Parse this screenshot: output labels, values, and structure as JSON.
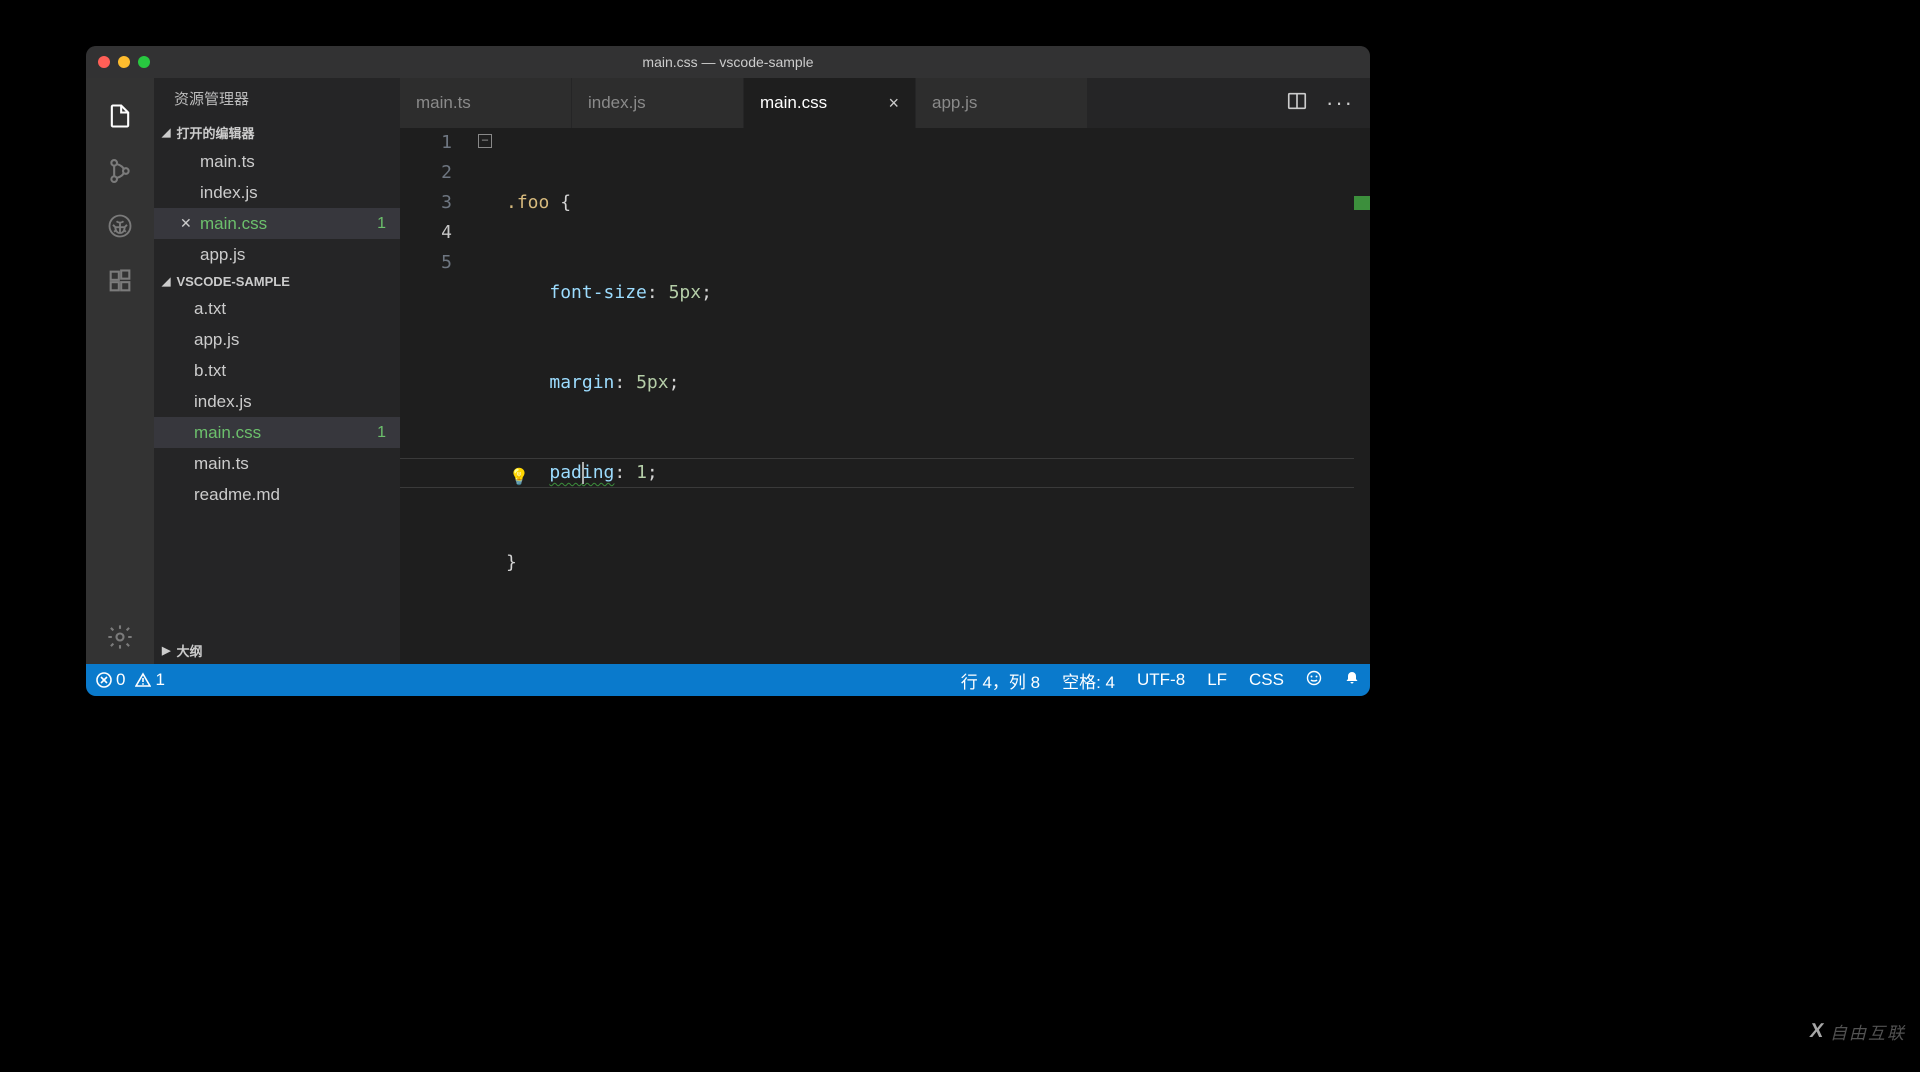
{
  "titlebar": {
    "title": "main.css — vscode-sample"
  },
  "sidebar": {
    "title": "资源管理器",
    "open_editors_label": "打开的编辑器",
    "workspace_label": "VSCODE-SAMPLE",
    "outline_label": "大纲",
    "open_editors": [
      {
        "name": "main.ts"
      },
      {
        "name": "index.js"
      },
      {
        "name": "main.css",
        "active": true,
        "badge": "1"
      },
      {
        "name": "app.js"
      }
    ],
    "files": [
      {
        "name": "a.txt"
      },
      {
        "name": "app.js"
      },
      {
        "name": "b.txt"
      },
      {
        "name": "index.js"
      },
      {
        "name": "main.css",
        "active": true,
        "badge": "1"
      },
      {
        "name": "main.ts"
      },
      {
        "name": "readme.md"
      }
    ]
  },
  "tabs": [
    {
      "label": "main.ts"
    },
    {
      "label": "index.js"
    },
    {
      "label": "main.css",
      "active": true
    },
    {
      "label": "app.js"
    }
  ],
  "code": {
    "l1_sel": ".foo",
    "l1_rest": " {",
    "l2_prop": "font-size",
    "l2_val": "5px",
    "l3_prop": "margin",
    "l3_val": "5px",
    "l4_prop_a": "pad",
    "l4_prop_b": "ing",
    "l4_val": "1",
    "l5": "}"
  },
  "status": {
    "errors": "0",
    "warnings": "1",
    "cursor": "行 4，列 8",
    "spaces": "空格: 4",
    "encoding": "UTF-8",
    "eol": "LF",
    "lang": "CSS"
  },
  "watermark": {
    "brand": "自由互联"
  }
}
